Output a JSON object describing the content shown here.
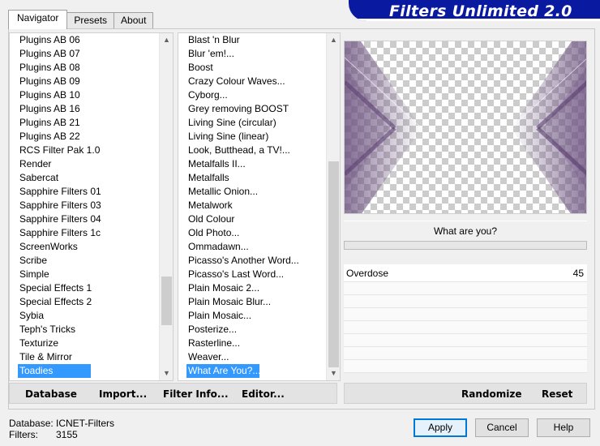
{
  "title": "Filters Unlimited 2.0",
  "tabs": [
    {
      "label": "Navigator",
      "active": true
    },
    {
      "label": "Presets",
      "active": false
    },
    {
      "label": "About",
      "active": false
    }
  ],
  "categories": {
    "items": [
      "Plugins AB 06",
      "Plugins AB 07",
      "Plugins AB 08",
      "Plugins AB 09",
      "Plugins AB 10",
      "Plugins AB 16",
      "Plugins AB 21",
      "Plugins AB 22",
      "RCS Filter Pak 1.0",
      "Render",
      "Sabercat",
      "Sapphire Filters 01",
      "Sapphire Filters 03",
      "Sapphire Filters 04",
      "Sapphire Filters 1c",
      "ScreenWorks",
      "Scribe",
      "Simple",
      "Special Effects 1",
      "Special Effects 2",
      "Sybia",
      "Teph's Tricks",
      "Texturize",
      "Tile & Mirror",
      "Toadies"
    ],
    "selected": "Toadies"
  },
  "filters": {
    "items": [
      "Blast 'n Blur",
      "Blur 'em!...",
      "Boost",
      "Crazy Colour Waves...",
      "Cyborg...",
      "Grey removing BOOST",
      "Living Sine (circular)",
      "Living Sine (linear)",
      "Look, Butthead, a TV!...",
      "Metalfalls II...",
      "Metalfalls",
      "Metallic Onion...",
      "Metalwork",
      "Old Colour",
      "Old Photo...",
      "Ommadawn...",
      "Picasso's Another Word...",
      "Picasso's Last Word...",
      "Plain Mosaic 2...",
      "Plain Mosaic Blur...",
      "Plain Mosaic...",
      "Posterize...",
      "Rasterline...",
      "Weaver...",
      "What Are You?..."
    ],
    "selected": "What Are You?..."
  },
  "preview": {
    "filter_title": "What are you?",
    "accent_color": "#6a4f7e"
  },
  "parameters": [
    {
      "name": "Overdose",
      "value": "45"
    }
  ],
  "buttons_left": {
    "database": "Database",
    "import": "Import...",
    "filter_info": "Filter Info...",
    "editor": "Editor..."
  },
  "buttons_right": {
    "randomize": "Randomize",
    "reset": "Reset"
  },
  "footer": {
    "database_label": "Database:",
    "database_value": "ICNET-Filters",
    "filters_label": "Filters:",
    "filters_value": "3155"
  },
  "dialog_buttons": {
    "apply": "Apply",
    "cancel": "Cancel",
    "help": "Help"
  }
}
